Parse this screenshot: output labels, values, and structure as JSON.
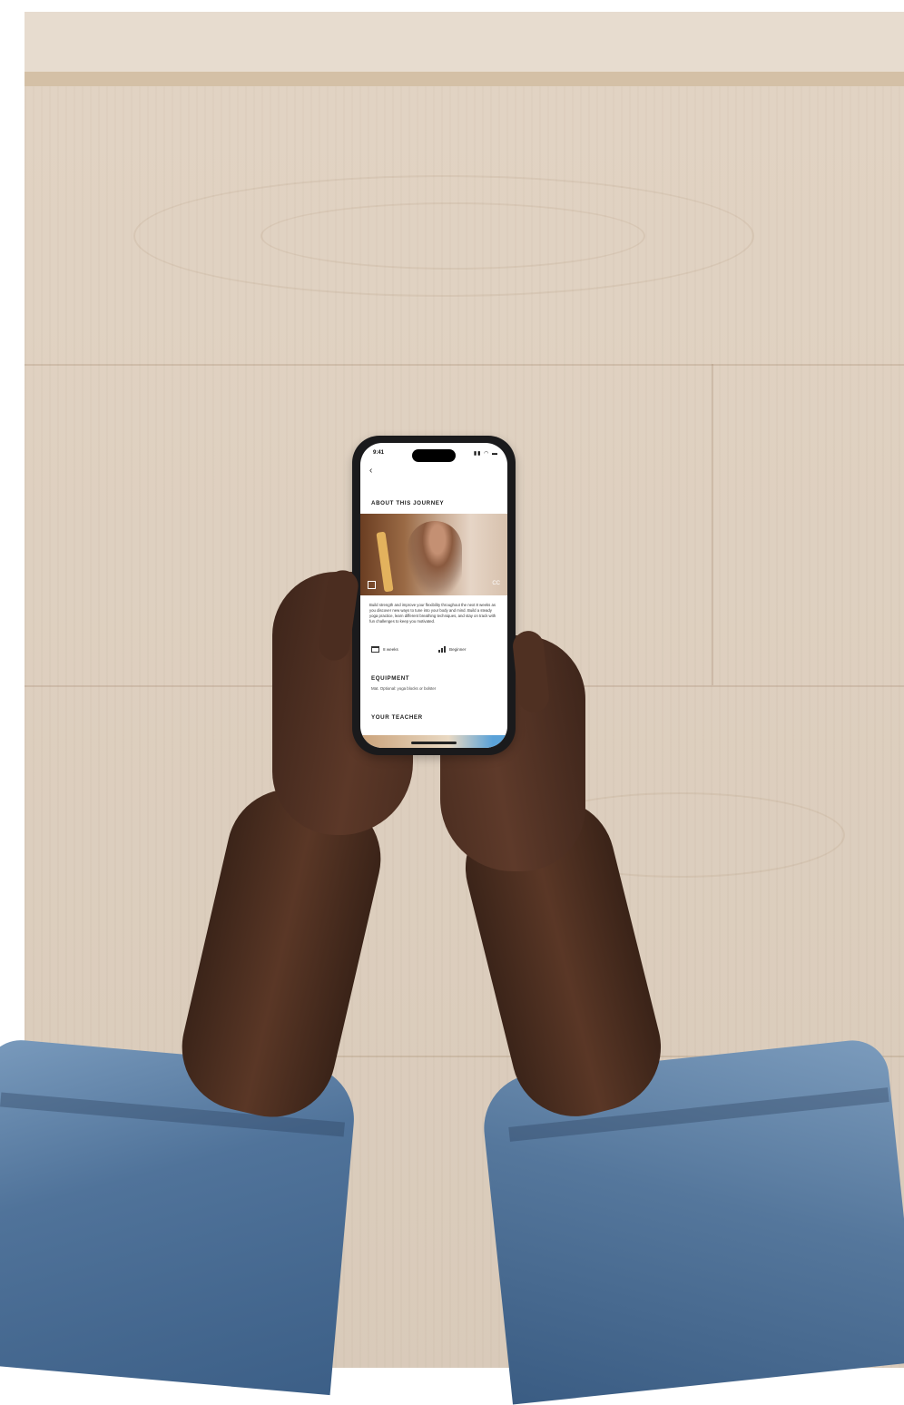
{
  "phone_app": {
    "status_time": "9:41",
    "back_glyph": "‹",
    "about_title": "ABOUT THIS JOURNEY",
    "description": "Build strength and improve your flexibility throughout the next 8 weeks as you discover new ways to tune into your body and mind. Build a steady yoga practice, learn different breathing techniques, and stay on track with fun challenges to keep you motivated.",
    "duration_label": "8 weeks",
    "level_label": "Beginner",
    "equipment_title": "EQUIPMENT",
    "equipment_text": "Mat. Optional: yoga blocks or bolster",
    "teacher_title": "YOUR TEACHER",
    "icons": {
      "expand": "expand-icon",
      "captions": "captions-icon",
      "calendar": "calendar-icon",
      "level": "level-bars-icon"
    }
  },
  "colors": {
    "floor": "#e0d1c0",
    "denim": "#50739a",
    "skin": "#4a2d20",
    "phone": "#1a1a1c"
  }
}
